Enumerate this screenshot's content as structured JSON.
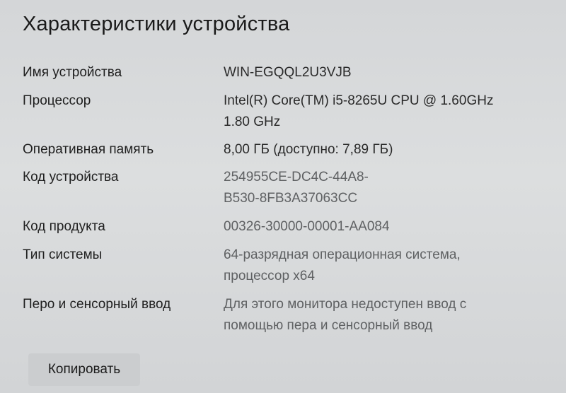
{
  "header": {
    "title": "Характеристики устройства"
  },
  "specs": [
    {
      "label": "Имя устройства",
      "value": "WIN-EGQQL2U3VJB"
    },
    {
      "label": "Процессор",
      "value": "Intel(R) Core(TM) i5-8265U CPU @ 1.60GHz\n1.80 GHz"
    },
    {
      "label": "Оперативная память",
      "value": "8,00 ГБ (доступно: 7,89 ГБ)"
    },
    {
      "label": "Код устройства",
      "value": "254955CE-DC4C-44A8-\nB530-8FB3A37063CC"
    },
    {
      "label": "Код продукта",
      "value": "00326-30000-00001-AA084"
    },
    {
      "label": "Тип системы",
      "value": "64-разрядная операционная система,\nпроцессор x64"
    },
    {
      "label": "Перо и сенсорный ввод",
      "value": "Для этого монитора недоступен ввод с\nпомощью пера и сенсорный ввод"
    }
  ],
  "actions": {
    "copy_label": "Копировать"
  }
}
